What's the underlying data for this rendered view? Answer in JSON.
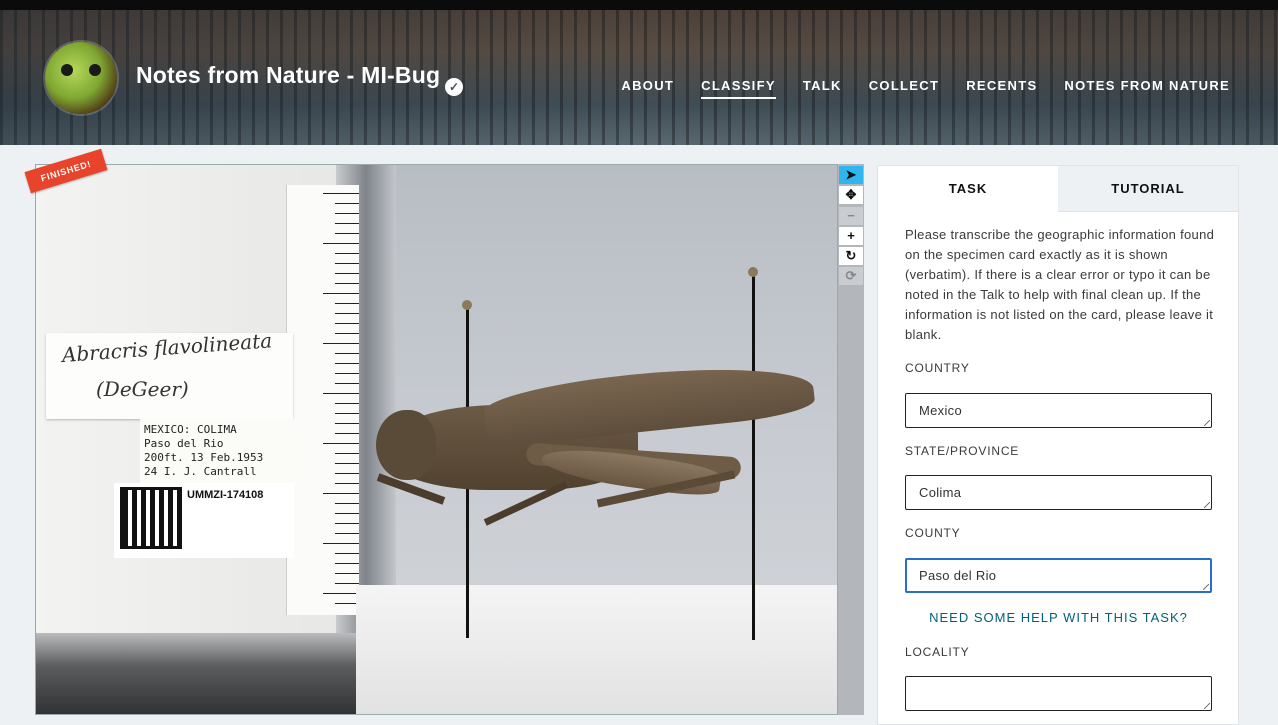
{
  "header": {
    "project_title": "Notes from Nature - MI-Bug",
    "verified_icon": "check-circle-icon",
    "nav": [
      {
        "label": "ABOUT",
        "active": false
      },
      {
        "label": "CLASSIFY",
        "active": true
      },
      {
        "label": "TALK",
        "active": false
      },
      {
        "label": "COLLECT",
        "active": false
      },
      {
        "label": "RECENTS",
        "active": false
      },
      {
        "label": "NOTES FROM NATURE",
        "active": false
      }
    ]
  },
  "subject": {
    "badge": "FINISHED!",
    "determination_label": {
      "line1": "Abracris flavolineata",
      "line2": "(DeGeer)"
    },
    "locality_label": [
      "MEXICO:     COLIMA",
      "  Paso del Rio",
      "200ft. 13 Feb.1953",
      "24  I. J. Cantrall"
    ],
    "catalog_number": "UMMZI-174108"
  },
  "toolbar": {
    "tools": [
      {
        "icon": "pointer-icon",
        "glyph": "➤",
        "state": "active"
      },
      {
        "icon": "move-icon",
        "glyph": "✥",
        "state": "normal"
      },
      {
        "icon": "zoom-out-icon",
        "glyph": "−",
        "state": "disabled"
      },
      {
        "icon": "zoom-in-icon",
        "glyph": "+",
        "state": "normal"
      },
      {
        "icon": "rotate-icon",
        "glyph": "↻",
        "state": "normal"
      },
      {
        "icon": "reset-icon",
        "glyph": "⟳",
        "state": "disabled"
      }
    ]
  },
  "task_panel": {
    "tabs": {
      "task": "TASK",
      "tutorial": "TUTORIAL"
    },
    "instructions": "Please transcribe the geographic information found on the specimen card exactly as it is shown (verbatim). If there is a clear error or typo it can be noted in the Talk to help with final clean up. If the information is not listed on the card, please leave it blank.",
    "fields": {
      "country": {
        "label": "COUNTRY",
        "value": "Mexico"
      },
      "state": {
        "label": "STATE/PROVINCE",
        "value": "Colima"
      },
      "county": {
        "label": "COUNTY",
        "value": "Paso del Rio"
      },
      "locality": {
        "label": "LOCALITY",
        "value": ""
      }
    },
    "help_link": "NEED SOME HELP WITH THIS TASK?"
  },
  "colors": {
    "accent": "#2fb6ee",
    "badge": "#e8442b",
    "link": "#00627a",
    "focus": "#2a6fc7"
  }
}
